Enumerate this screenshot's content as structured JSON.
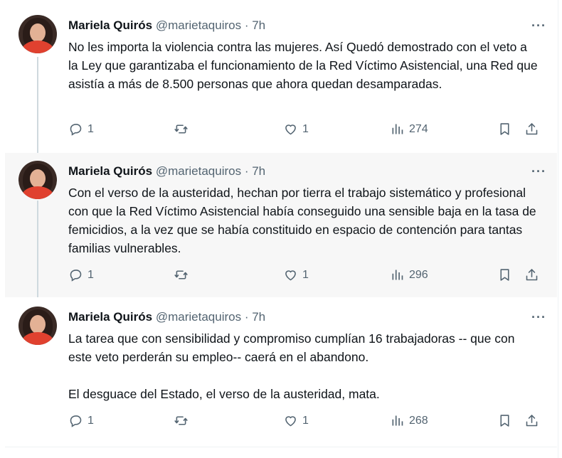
{
  "tweets": [
    {
      "author": "Mariela Quirós",
      "handle": "@marietaquiros",
      "time": "· 7h",
      "paragraphs": [
        "No les importa la violencia contra las mujeres. Así Quedó demostrado con el veto a la Ley que garantizaba el funcionamiento de la Red Víctimo Asistencial, una Red que asistía a más de 8.500 personas que ahora quedan desamparadas."
      ],
      "replies": "1",
      "likes": "1",
      "views": "274"
    },
    {
      "author": "Mariela Quirós",
      "handle": "@marietaquiros",
      "time": "· 7h",
      "paragraphs": [
        "Con el verso de la austeridad, hechan por tierra el trabajo sistemático y profesional con que la Red Víctimo Asistencial había conseguido una sensible baja en la tasa de femicidios, a la vez que se había constituido en espacio de contención para tantas familias vulnerables."
      ],
      "replies": "1",
      "likes": "1",
      "views": "296"
    },
    {
      "author": "Mariela Quirós",
      "handle": "@marietaquiros",
      "time": "· 7h",
      "paragraphs": [
        "La tarea que con sensibilidad y compromiso cumplían 16 trabajadoras -- que con este veto perderán su empleo-- caerá en el abandono.",
        "El desguace del Estado, el verso de la austeridad, mata."
      ],
      "replies": "1",
      "likes": "1",
      "views": "268"
    }
  ],
  "more_label": "···",
  "icons": {
    "reply": "reply-icon",
    "repost": "repost-icon",
    "like": "heart-icon",
    "views": "views-icon",
    "bookmark": "bookmark-icon",
    "share": "share-icon",
    "more": "more-icon"
  },
  "colors": {
    "text": "#0f1419",
    "secondary": "#536471",
    "thread_line": "#cfd9de",
    "highlight_bg": "#f7f7f7"
  }
}
